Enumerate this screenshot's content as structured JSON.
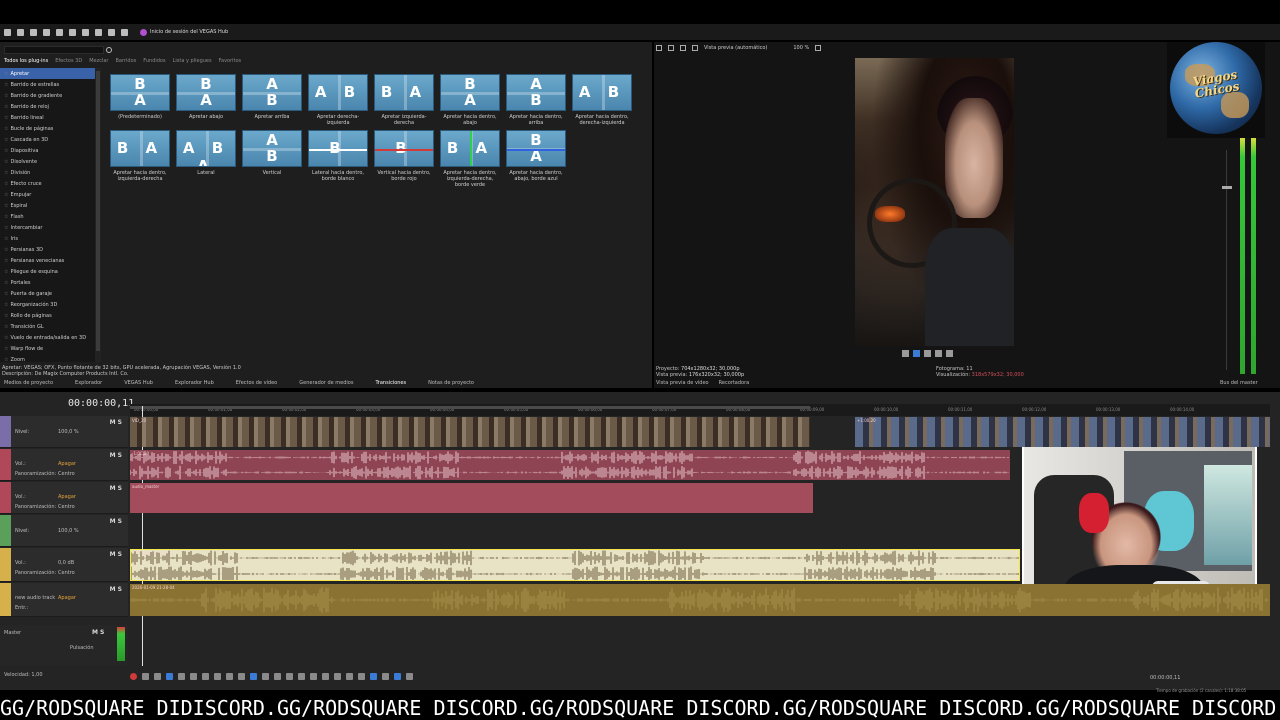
{
  "app": {
    "hub_label": "Inicio de sesión del VEGAS Hub"
  },
  "plugin_tabs": [
    "Todos los plug-ins",
    "Efectos 3D",
    "Mezclar",
    "Barridos",
    "Fundidos",
    "Lista y pliegues",
    "Favoritos"
  ],
  "transitions": [
    "Apretar",
    "Barrido de estrellas",
    "Barrido de gradiente",
    "Barrido de reloj",
    "Barrido lineal",
    "Bucle de páginas",
    "Cascada en 3D",
    "Diapositiva",
    "Disolvente",
    "División",
    "Efecto cruce",
    "Empujar",
    "Espiral",
    "Flash",
    "Intercambiar",
    "Iris",
    "Persianas 3D",
    "Persianas venecianas",
    "Pliegue de esquina",
    "Portales",
    "Puerta de garaje",
    "Reorganización 3D",
    "Rollo de páginas",
    "Transición GL",
    "Vuelo de entrada/salida en 3D",
    "Warp flow de",
    "Zoom"
  ],
  "thumbnails": [
    {
      "caption": "(Predeterminado)",
      "glyph": "B/A"
    },
    {
      "caption": "Apretar abajo",
      "glyph": "B/A"
    },
    {
      "caption": "Apretar arriba",
      "glyph": "A/B"
    },
    {
      "caption": "Apretar derecha-izquierda",
      "glyph": "A B"
    },
    {
      "caption": "Apretar izquierda-derecha",
      "glyph": "B A"
    },
    {
      "caption": "Apretar hacia dentro, abajo",
      "glyph": "B/A"
    },
    {
      "caption": "Apretar hacia dentro, arriba",
      "glyph": "A/B"
    },
    {
      "caption": "Apretar hacia dentro, derecha-izquierda",
      "glyph": "A B"
    },
    {
      "caption": "Apretar hacia dentro, izquierda-derecha",
      "glyph": "B A"
    },
    {
      "caption": "Lateral",
      "glyph": "A B A"
    },
    {
      "caption": "Vertical",
      "glyph": "A/B"
    },
    {
      "caption": "Lateral hacia dentro, borde blanco",
      "glyph": "B"
    },
    {
      "caption": "Vertical hacia dentro, borde rojo",
      "glyph": "B"
    },
    {
      "caption": "Apretar hacia dentro, izquierda-derecha, borde verde",
      "glyph": "B A"
    },
    {
      "caption": "Apretar hacia dentro, abajo, borde azul",
      "glyph": "B/A"
    }
  ],
  "status": {
    "line1": "Apretar: VEGAS; OFX, Punto flotante de 32 bits, GPU acelerada, Agrupación VEGAS, Versión 1.0",
    "line2": "Descripción: De Magix Computer Products Intl. Co."
  },
  "left_bottom_tabs": [
    "Medios de proyecto",
    "Explorador",
    "VEGAS Hub",
    "Explorador Hub",
    "Efectos de vídeo",
    "Generador de medios",
    "Transiciones",
    "Notas de proyecto"
  ],
  "preview": {
    "mode_label": "Vista previa (automático)",
    "zoom": "100 %",
    "proyecto_label": "Proyecto:",
    "proyecto_value": "704x1280x32; 30,000p",
    "vista_label": "Vista previa:",
    "vista_value": "176x320x32; 30,000p",
    "fotograma_label": "Fotograma:",
    "fotograma_value": "11",
    "visualizacion_label": "Visualización:",
    "visualizacion_value": "318x579x32; 30,000",
    "tabs": [
      "Vista previa de vídeo",
      "Recortadora"
    ],
    "bus_label": "Bus del master"
  },
  "logo_text": "Viagos Chicos",
  "timeline": {
    "timecode": "00:00:00,11",
    "ruler_ticks": [
      "00:00:00,00",
      "00:00:01,00",
      "00:00:02,00",
      "00:00:03,00",
      "00:00:04,00",
      "00:00:05,00",
      "00:00:06,00",
      "00:00:07,00",
      "00:00:08,00",
      "00:00:09,00",
      "00:00:10,00",
      "00:00:11,00",
      "00:00:12,00",
      "00:00:13,00",
      "00:00:14,00"
    ],
    "tracks": [
      {
        "type": "video",
        "label1": "Nivel:",
        "value1": "100,0 %",
        "color": "#7b6ea8"
      },
      {
        "type": "audio",
        "label1": "Vol.:",
        "value1": "Apagar",
        "label2": "Panoramización:",
        "value2": "Centro",
        "color": "#b0485a"
      },
      {
        "type": "audio",
        "label1": "Vol.:",
        "value1": "Apagar",
        "label2": "Panoramización:",
        "value2": "Centro",
        "color": "#b0485a"
      },
      {
        "type": "video",
        "label1": "Nivel:",
        "value1": "100,0 %",
        "color": "#5aa05a"
      },
      {
        "type": "audio",
        "label1": "Vol.:",
        "value1": "0,0 dB",
        "label2": "Panoramización:",
        "value2": "Centro",
        "color": "#d6b04a"
      },
      {
        "type": "audio",
        "label1": "new audio track",
        "value1": "Apagar",
        "label2": "Entr.:",
        "value2": "",
        "color": "#d6b04a"
      }
    ],
    "clip_labels": [
      "VID_20",
      "-1:0C,20",
      "2026-01-08 21-28-2",
      "+1:00,20",
      "audio_master",
      "2026-01-09 21-28-04",
      "2026-01-09 21-28-04"
    ],
    "ms_label": "M S",
    "master_label": "Master",
    "pulsacion_label": "Pulsación",
    "speed": "Velocidad: 1,00",
    "end_timecode": "00:00:00,11",
    "rec_status": "Tiempo de grabación (2 canales): 1:18:38:05"
  },
  "ticker": "GG/RODSQUARE DIDISCORD.GG/RODSQUARE DISCORD.GG/RODSQUARE DISCORD.GG/RODSQUARE DISCORD.GG/RODSQUARE DISCORD"
}
